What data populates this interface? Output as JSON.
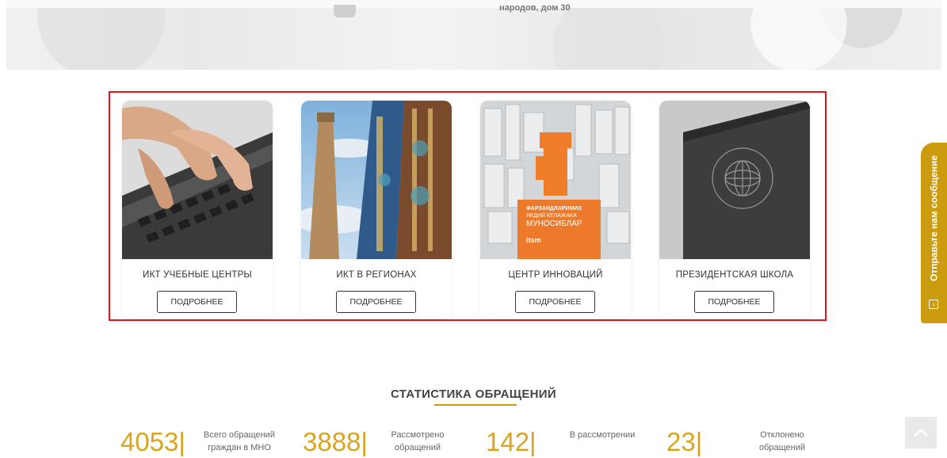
{
  "banner": {
    "address_text": "народов, дом 30"
  },
  "cards": [
    {
      "title": "ИКТ УЧЕБНЫЕ ЦЕНТРЫ",
      "button": "ПОДРОБНЕЕ"
    },
    {
      "title": "ИКТ В РЕГИОНАХ",
      "button": "ПОДРОБНЕЕ"
    },
    {
      "title": "ЦЕНТР ИННОВАЦИЙ",
      "button": "ПОДРОБНЕЕ",
      "poster": {
        "line1": "ФАРЗАНДЛАРИМИЗ",
        "line2": "ЯКДИЙ КЕЛАЖАКА",
        "line3": "МУНОСИБЛАР",
        "logo": "itsm"
      }
    },
    {
      "title": "ПРЕЗИДЕНТСКАЯ ШКОЛА",
      "button": "ПОДРОБНЕЕ"
    }
  ],
  "side_tab": {
    "label": "Отправьте нам сообщение",
    "icon": "chevron-right-icon"
  },
  "stats": {
    "title": "СТАТИСТИКА ОБРАЩЕНИЙ",
    "items": [
      {
        "value": "4053|",
        "label_line1": "Всего обращений",
        "label_line2": "граждан в МНО"
      },
      {
        "value": "3888|",
        "label_line1": "Рассмотрено",
        "label_line2": "обращений"
      },
      {
        "value": "142|",
        "label_line1": "В рассмотрении",
        "label_line2": ""
      },
      {
        "value": "23|",
        "label_line1": "Отклонено",
        "label_line2": "обращений"
      }
    ]
  },
  "scroll_top": {
    "icon": "chevron-up-icon"
  },
  "colors": {
    "accent": "#cc9b0e",
    "stat_number": "#d9a520",
    "highlight_border": "#e3141b"
  }
}
